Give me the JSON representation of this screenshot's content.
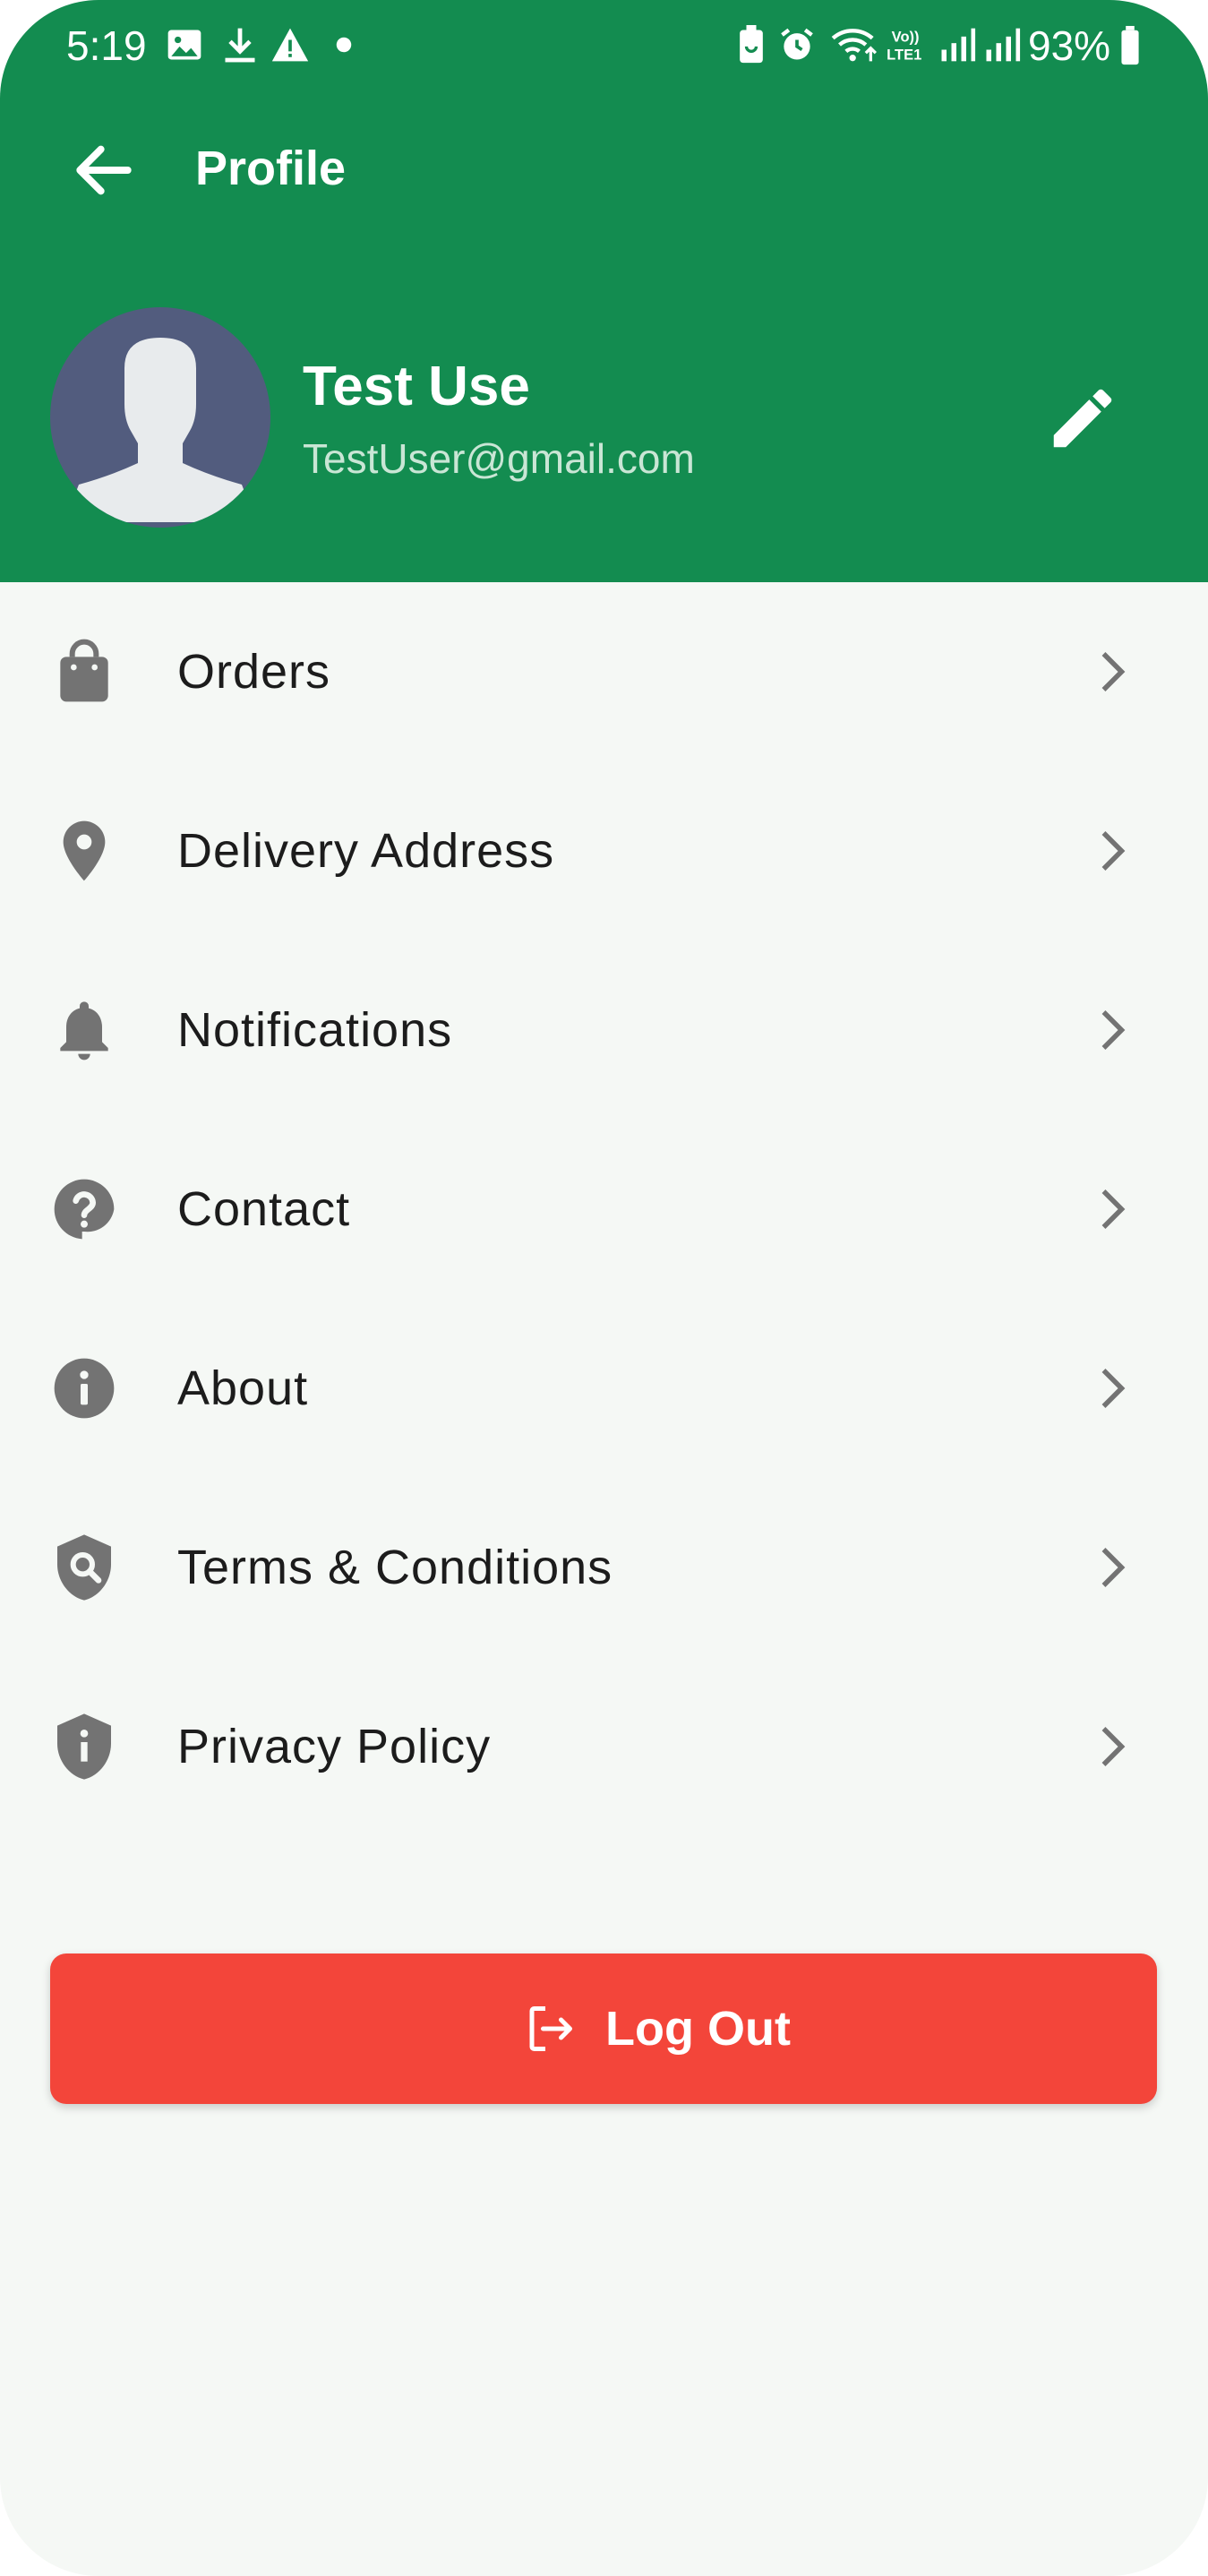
{
  "status_bar": {
    "time": "5:19",
    "battery": "93%"
  },
  "app_bar": {
    "title": "Profile"
  },
  "profile": {
    "name": "Test Use",
    "email": "TestUser@gmail.com"
  },
  "menu": {
    "items": [
      {
        "label": "Orders",
        "icon": "shopping-bag-icon"
      },
      {
        "label": "Delivery Address",
        "icon": "location-pin-icon"
      },
      {
        "label": "Notifications",
        "icon": "bell-icon"
      },
      {
        "label": "Contact",
        "icon": "help-circle-icon"
      },
      {
        "label": "About",
        "icon": "info-icon"
      },
      {
        "label": "Terms & Conditions",
        "icon": "shield-search-icon"
      },
      {
        "label": "Privacy Policy",
        "icon": "shield-info-icon"
      }
    ]
  },
  "logout": {
    "label": "Log Out"
  },
  "colors": {
    "primary": "#138c50",
    "logout": "#f3453a",
    "background": "#f5f8f5",
    "icon": "#737373",
    "avatar": "#525c7e"
  }
}
